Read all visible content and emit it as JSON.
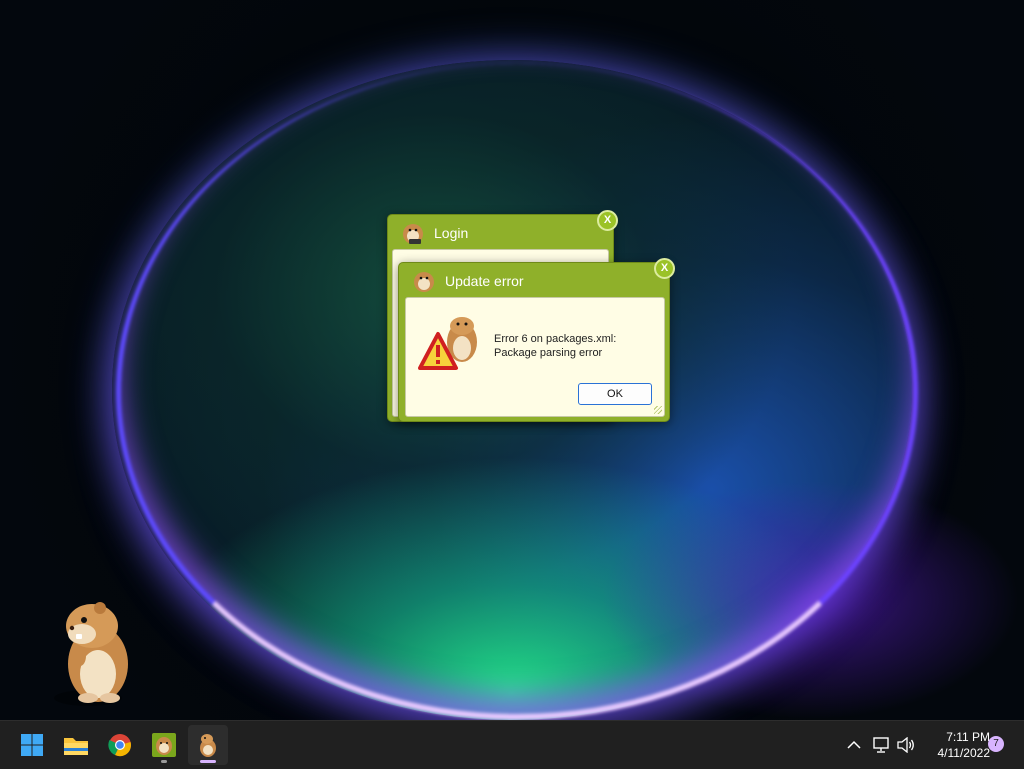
{
  "desktop": {
    "pet_name": "hamster-pet"
  },
  "dialogs": {
    "login": {
      "title": "Login",
      "close_label": "X"
    },
    "update_error": {
      "title": "Update error",
      "close_label": "X",
      "message": "Error 6 on packages.xml: Package parsing error",
      "ok_label": "OK"
    }
  },
  "taskbar": {
    "apps": [
      {
        "name": "start",
        "icon": "windows-logo-icon"
      },
      {
        "name": "file-explorer",
        "icon": "folder-icon"
      },
      {
        "name": "chrome",
        "icon": "chrome-icon"
      },
      {
        "name": "hamster-app",
        "icon": "hamster-app-icon"
      },
      {
        "name": "hamster-pet",
        "icon": "hamster-icon"
      }
    ],
    "tray": {
      "time": "7:11 PM",
      "date": "4/11/2022",
      "notification_count": "7"
    }
  },
  "colors": {
    "dialog_green": "#8fb02a",
    "dialog_body": "#fffde5",
    "ok_border": "#2a72d6",
    "taskbar": "#202020",
    "notif_badge": "#d8b4fe"
  }
}
